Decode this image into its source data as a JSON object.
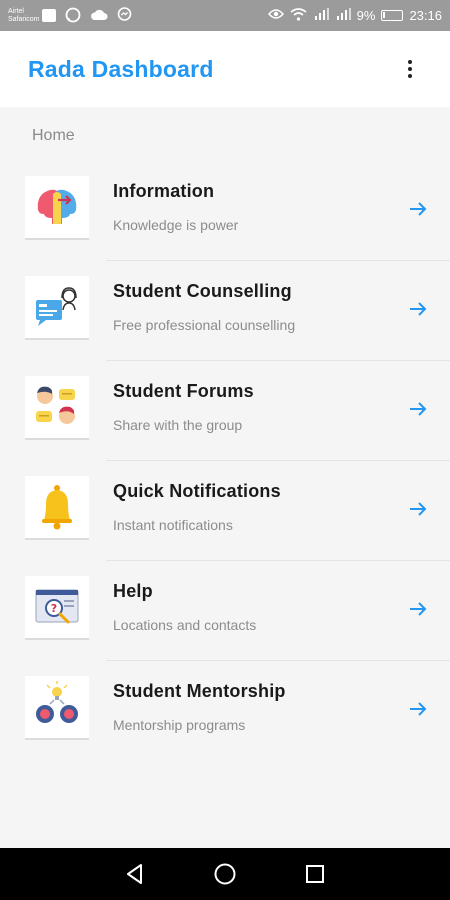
{
  "status_bar": {
    "carrier_line1": "Airtel",
    "carrier_line2": "Safaricom",
    "battery_percent": "9%",
    "time": "23:16",
    "icons": [
      "image-icon",
      "whatsapp-icon",
      "cloud-icon",
      "messenger-icon",
      "eye-icon",
      "wifi-icon",
      "signal-icon",
      "signal-icon",
      "battery-icon"
    ]
  },
  "app_bar": {
    "title": "Rada Dashboard"
  },
  "breadcrumb": "Home",
  "items": [
    {
      "title": "Information",
      "subtitle": "Knowledge is power",
      "icon": "heads-icon"
    },
    {
      "title": "Student Counselling",
      "subtitle": "Free professional counselling",
      "icon": "counselling-icon"
    },
    {
      "title": "Student Forums",
      "subtitle": "Share with the group",
      "icon": "forum-icon"
    },
    {
      "title": "Quick Notifications",
      "subtitle": "Instant notifications",
      "icon": "bell-icon"
    },
    {
      "title": "Help",
      "subtitle": "Locations and contacts",
      "icon": "help-icon"
    },
    {
      "title": "Student Mentorship",
      "subtitle": "Mentorship programs",
      "icon": "mentorship-icon"
    }
  ],
  "colors": {
    "accent": "#2196f3",
    "background": "#f5f5f5"
  }
}
